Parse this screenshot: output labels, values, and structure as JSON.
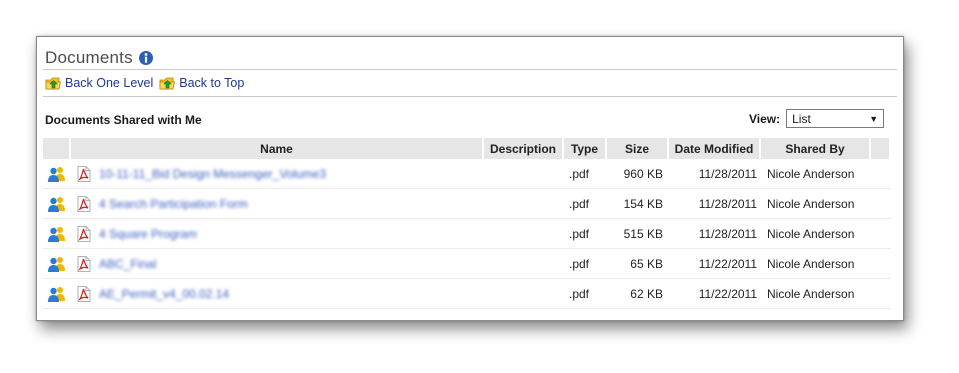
{
  "header": {
    "title": "Documents",
    "info_icon": "info-icon"
  },
  "nav": {
    "back_one_level": "Back One Level",
    "back_to_top": "Back to Top",
    "folder_icon": "folder-up-icon"
  },
  "section": {
    "title": "Documents Shared with Me"
  },
  "view": {
    "label": "View:",
    "selected": "List"
  },
  "table": {
    "columns": [
      "",
      "Name",
      "Description",
      "Type",
      "Size",
      "Date Modified",
      "Shared By"
    ],
    "rows": [
      {
        "name": "10-11-11_Bid Design Messenger_Volume3",
        "description": "",
        "type": ".pdf",
        "size": "960 KB",
        "date": "11/28/2011",
        "shared_by": "Nicole Anderson"
      },
      {
        "name": "4 Search Participation Form",
        "description": "",
        "type": ".pdf",
        "size": "154 KB",
        "date": "11/28/2011",
        "shared_by": "Nicole Anderson"
      },
      {
        "name": "4 Square Program",
        "description": "",
        "type": ".pdf",
        "size": "515 KB",
        "date": "11/28/2011",
        "shared_by": "Nicole Anderson"
      },
      {
        "name": "ABC_Final",
        "description": "",
        "type": ".pdf",
        "size": "65 KB",
        "date": "11/22/2011",
        "shared_by": "Nicole Anderson"
      },
      {
        "name": "AE_Permit_v4_00.02.14",
        "description": "",
        "type": ".pdf",
        "size": "62 KB",
        "date": "11/22/2011",
        "shared_by": "Nicole Anderson"
      }
    ]
  },
  "colors": {
    "link": "#1e3a8a",
    "header_bg": "#e6e6e6",
    "people_icon_blue": "#2b7bd6",
    "people_icon_yellow": "#f2b705",
    "pdf_red": "#cc1f1f"
  }
}
